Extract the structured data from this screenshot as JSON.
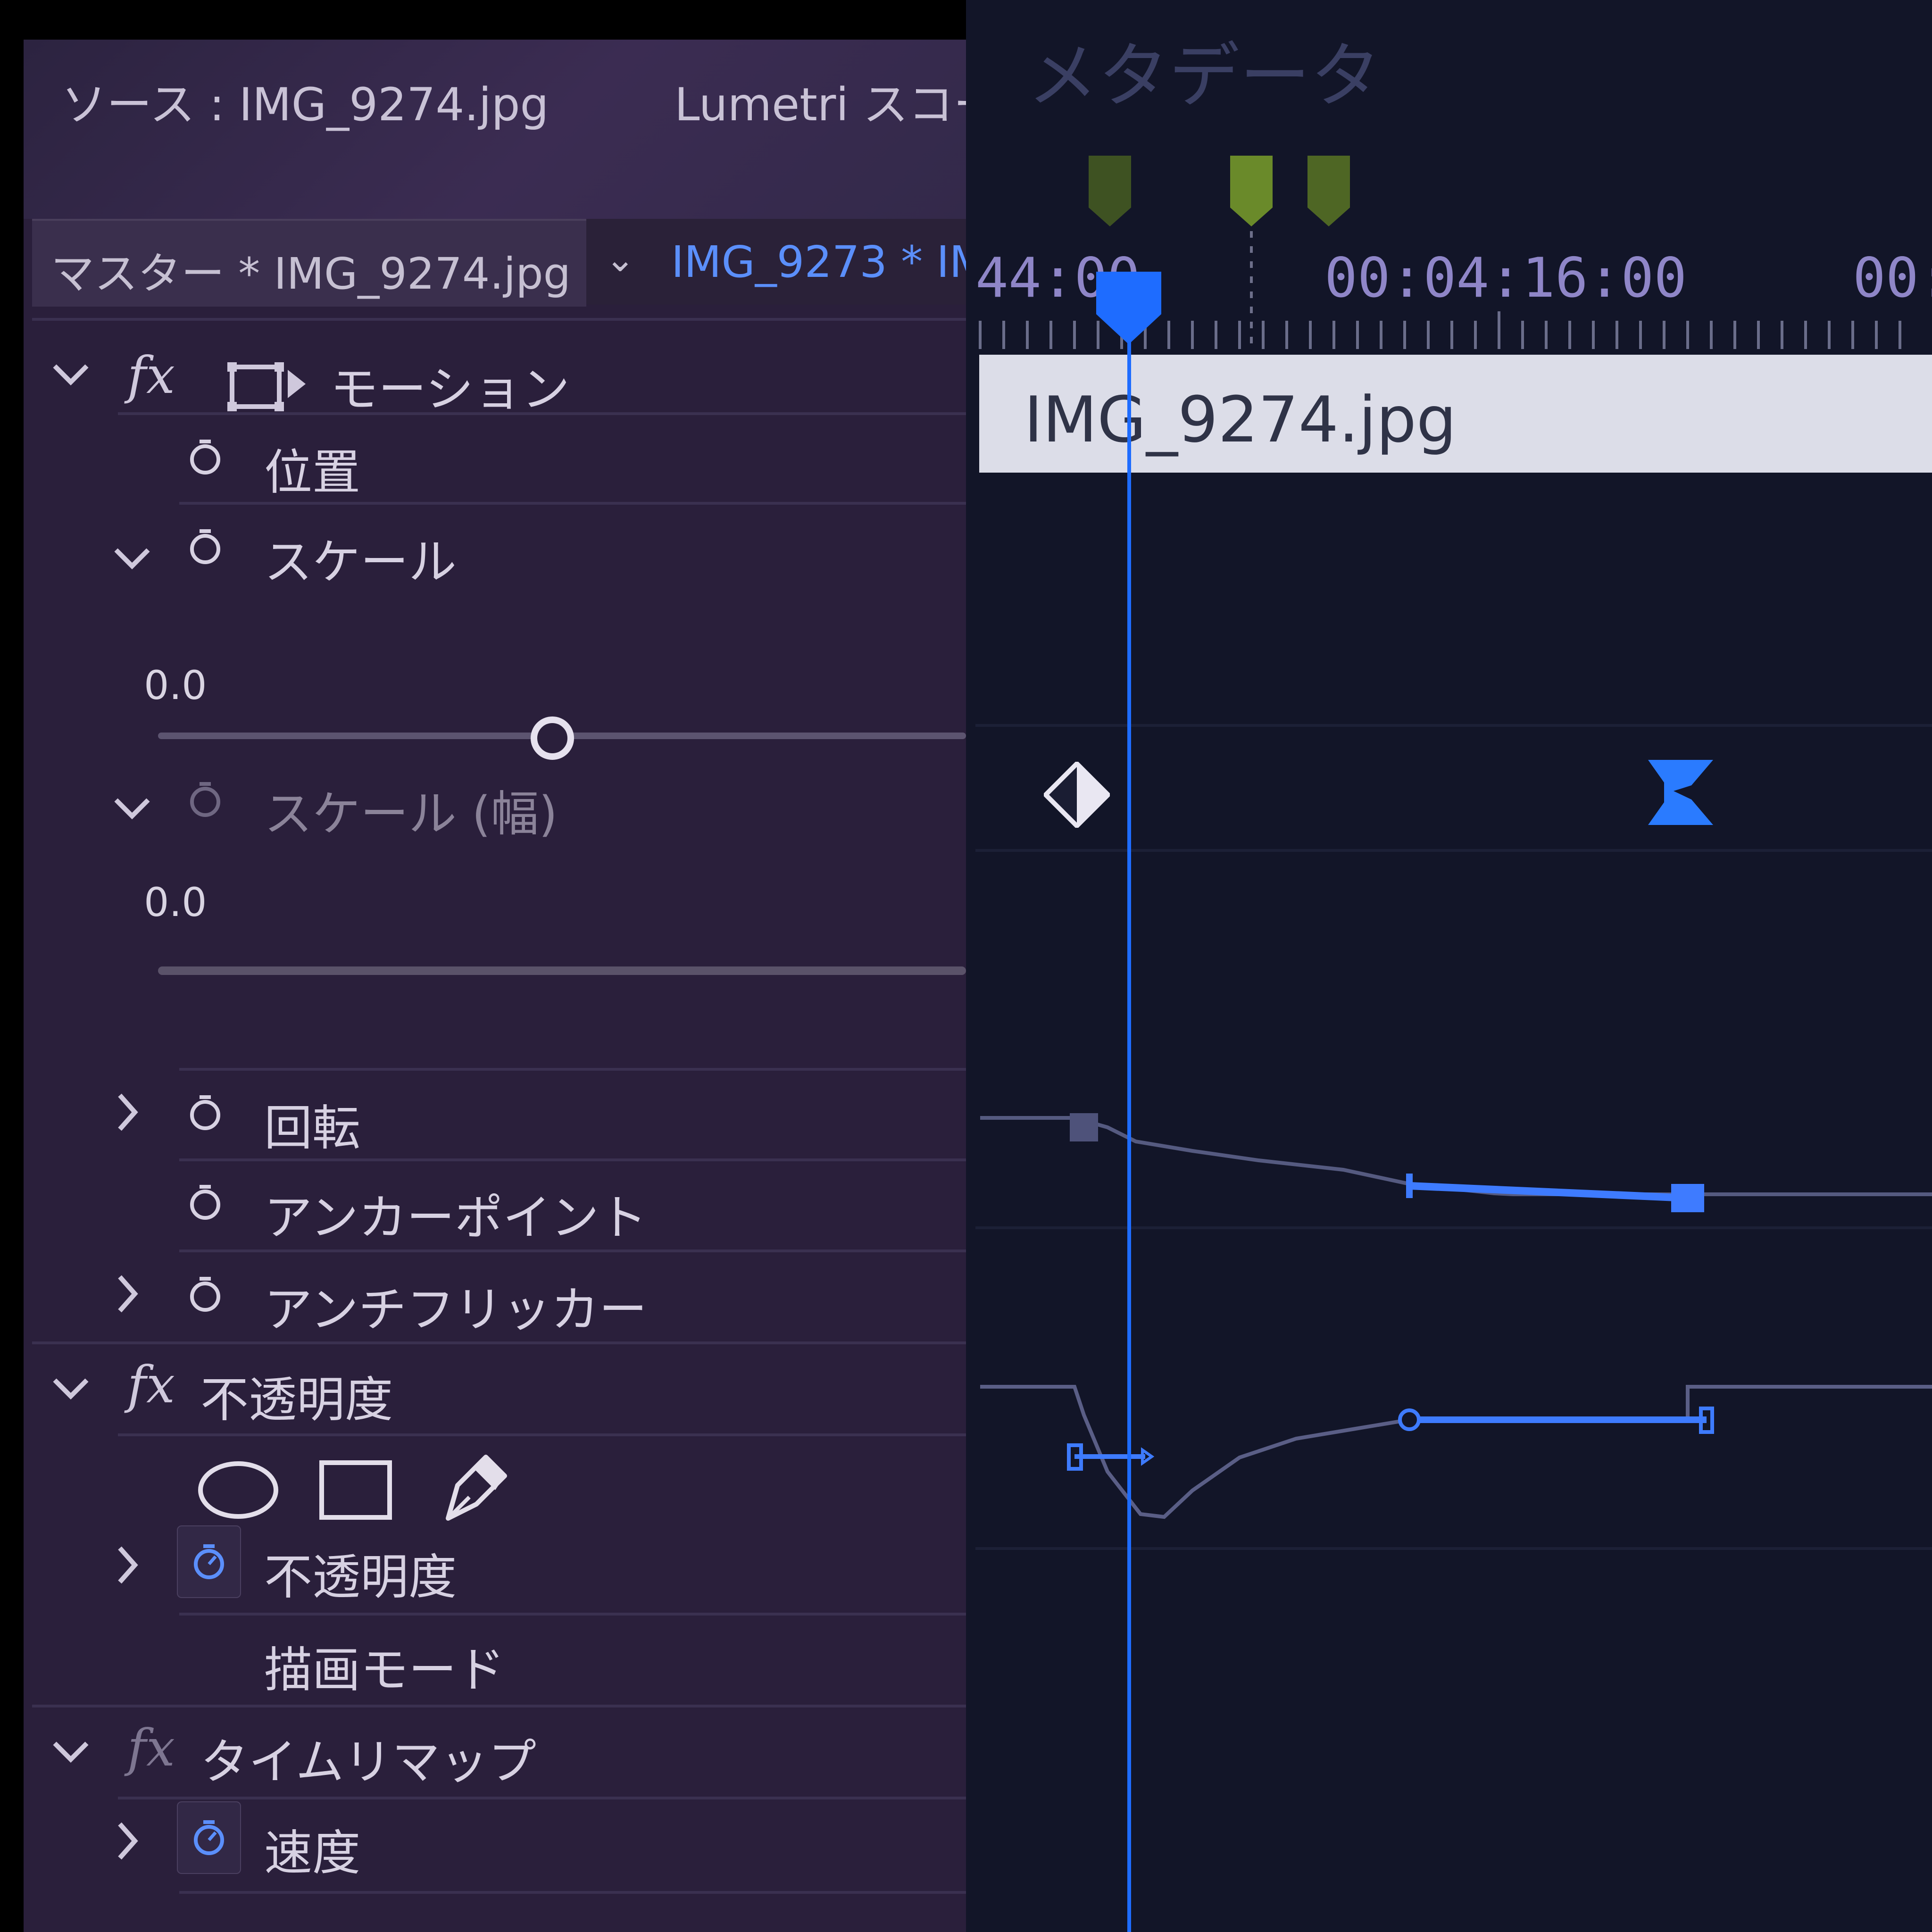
{
  "left_panel": {
    "tabs": {
      "source": "ソース : IMG_9274.jpg",
      "lumetri": "Lumetri スコー"
    },
    "master_tab": "マスター * IMG_9274.jpg",
    "clip_tab": "IMG_9273 * IM",
    "motion": {
      "fx": "fx",
      "label": "モーション",
      "position": "位置",
      "scale": "スケール",
      "scale_value": "0.0",
      "scale_width": "スケール (幅)",
      "scale_width_value": "0.0",
      "rotation": "回転",
      "anchor_point": "アンカーポイント",
      "anti_flicker": "アンチフリッカー"
    },
    "opacity": {
      "fx": "fx",
      "label": "不透明度",
      "param": "不透明度",
      "blend_mode": "描画モード"
    },
    "time_remap": {
      "fx": "fx",
      "label": "タイムリマップ",
      "speed": "速度"
    }
  },
  "right_panel": {
    "metadata_title": "メタデータ",
    "timecodes": {
      "left": "44:00",
      "middle": "00:04:16:00",
      "right": "00:"
    },
    "clip_name": "IMG_9274.jpg",
    "colors": {
      "playhead": "#1e6cff",
      "marker": "#5f7a2a",
      "clip_bar": "#dcdde8",
      "panel_bg": "#121528",
      "left_bg": "#2a1f3b"
    }
  }
}
